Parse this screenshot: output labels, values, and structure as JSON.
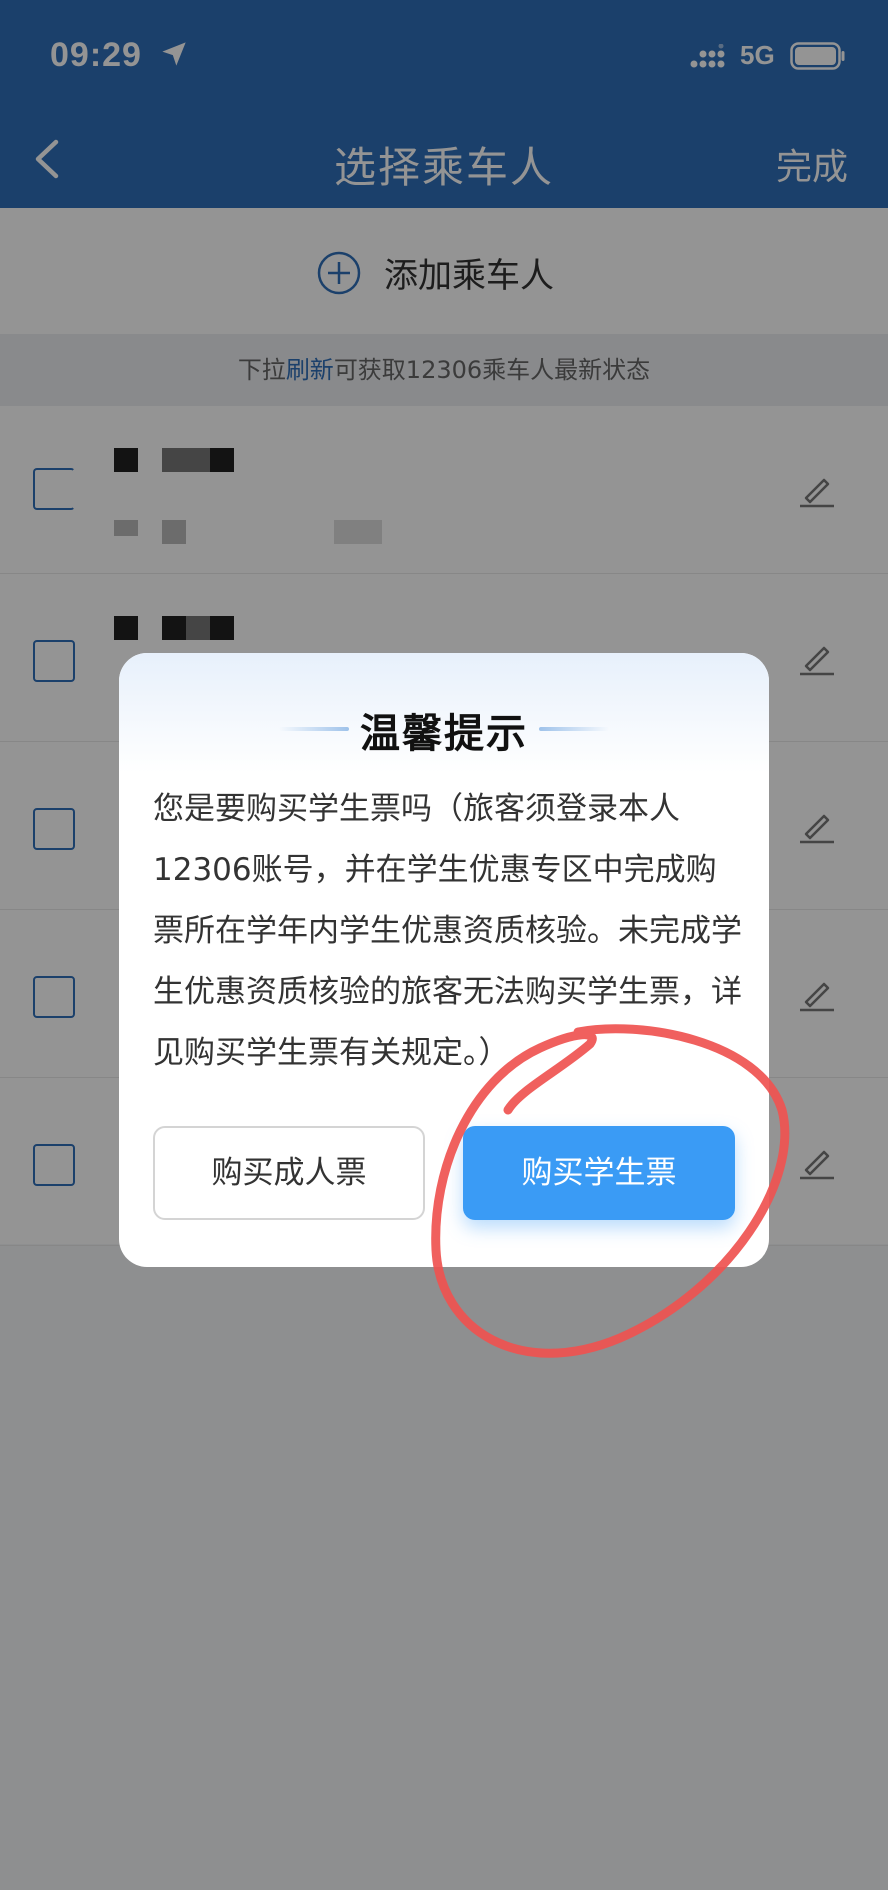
{
  "status_bar": {
    "time": "09:29",
    "network": "5G"
  },
  "header": {
    "title": "选择乘车人",
    "done_label": "完成"
  },
  "add_passenger": {
    "label": "添加乘车人"
  },
  "refresh_tip": {
    "prefix": "下拉",
    "link": "刷新",
    "suffix": "可获取12306乘车人最新状态"
  },
  "dialog": {
    "title": "温馨提示",
    "body": "您是要购买学生票吗（旅客须登录本人12306账号，并在学生优惠专区中完成购票所在学年内学生优惠资质核验。未完成学生优惠资质核验的旅客无法购买学生票，详见购买学生票有关规定。）",
    "adult_button": "购买成人票",
    "student_button": "购买学生票"
  },
  "colors": {
    "header": "#2f6fb8",
    "accent": "#3a9bf5",
    "annotation": "#ef5350"
  }
}
